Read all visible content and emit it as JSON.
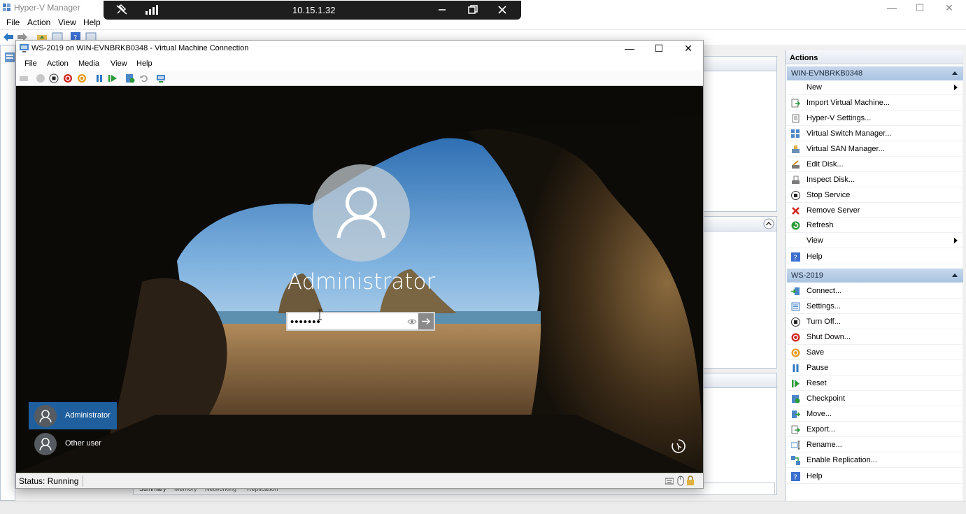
{
  "hyperv": {
    "title": "Hyper-V Manager",
    "menu": [
      "File",
      "Action",
      "View",
      "Help"
    ],
    "bottom_tabs": [
      "Summary",
      "Memory",
      "Networking",
      "Replication"
    ]
  },
  "rdp_bar": {
    "address": "10.15.1.32"
  },
  "vm": {
    "title": "WS-2019 on WIN-EVNBRKB0348 - Virtual Machine Connection",
    "menu": [
      "File",
      "Action",
      "Media",
      "View",
      "Help"
    ],
    "status": "Status: Running",
    "lock_screen": {
      "username": "Administrator",
      "password_value": "•••••••",
      "users": [
        "Administrator",
        "Other user"
      ]
    }
  },
  "actions": {
    "title": "Actions",
    "server_section": "WIN-EVNBRKB0348",
    "server_items": [
      "New",
      "Import Virtual Machine...",
      "Hyper-V Settings...",
      "Virtual Switch Manager...",
      "Virtual SAN Manager...",
      "Edit Disk...",
      "Inspect Disk...",
      "Stop Service",
      "Remove Server",
      "Refresh",
      "View",
      "Help"
    ],
    "vm_section": "WS-2019",
    "vm_items": [
      "Connect...",
      "Settings...",
      "Turn Off...",
      "Shut Down...",
      "Save",
      "Pause",
      "Reset",
      "Checkpoint",
      "Move...",
      "Export...",
      "Rename...",
      "Enable Replication...",
      "Help"
    ]
  },
  "colors": {
    "section_header": "#b9cde6",
    "rdp_bar": "#1e1e1e",
    "user_tile_selected": "#1f5f9e"
  }
}
